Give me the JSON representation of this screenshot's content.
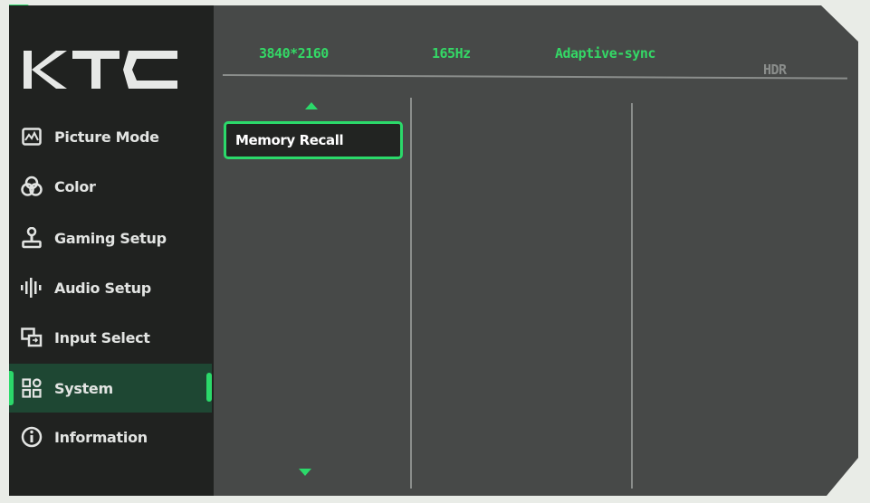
{
  "brand": {
    "logo_text": "KTC"
  },
  "status_bar": {
    "resolution": "3840*2160",
    "refresh": "165Hz",
    "sync": "Adaptive-sync",
    "hdr": "HDR"
  },
  "sidebar": {
    "items": [
      {
        "label": "Picture Mode",
        "icon": "picture-mode-icon",
        "active": false
      },
      {
        "label": "Color",
        "icon": "color-icon",
        "active": false
      },
      {
        "label": "Gaming Setup",
        "icon": "joystick-icon",
        "active": false
      },
      {
        "label": "Audio Setup",
        "icon": "audio-icon",
        "active": false
      },
      {
        "label": "Input Select",
        "icon": "input-select-icon",
        "active": false
      },
      {
        "label": "System",
        "icon": "system-grid-icon",
        "active": true
      },
      {
        "label": "Information",
        "icon": "info-icon",
        "active": false
      }
    ]
  },
  "submenu": {
    "items": [
      {
        "label": "Memory Recall",
        "selected": true
      }
    ]
  },
  "colors": {
    "accent": "#2bd96a",
    "sidebar_bg": "#202220",
    "panel_bg": "#474948",
    "active_item_bg": "#1e4733"
  }
}
